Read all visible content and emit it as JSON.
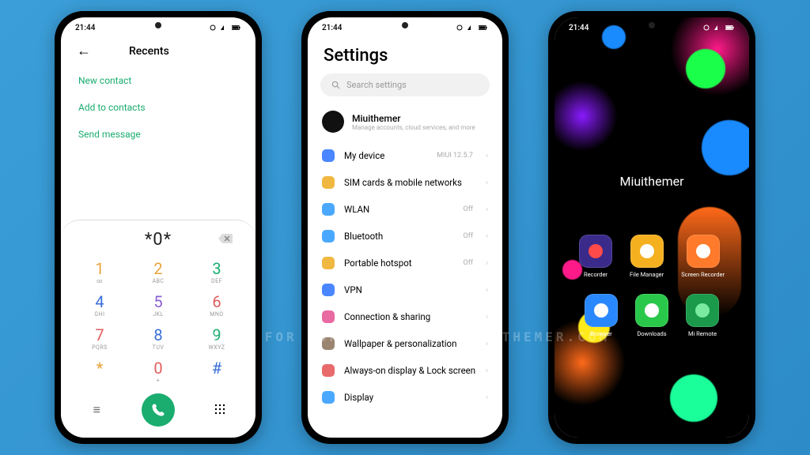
{
  "status": {
    "time": "21:44"
  },
  "watermark": "VISIT FOR MORE THEMES - MIUITHEMER.COM",
  "phone1": {
    "title": "Recents",
    "actions": [
      "New contact",
      "Add to contacts",
      "Send message"
    ],
    "dialed": "*0*",
    "keys": [
      {
        "d": "1",
        "l": "∞",
        "c": "#e8a33c"
      },
      {
        "d": "2",
        "l": "ABC",
        "c": "#e8a33c"
      },
      {
        "d": "3",
        "l": "DEF",
        "c": "#1aad6f"
      },
      {
        "d": "4",
        "l": "GHI",
        "c": "#3a6fd8"
      },
      {
        "d": "5",
        "l": "JKL",
        "c": "#8a5fd1"
      },
      {
        "d": "6",
        "l": "MNO",
        "c": "#e25b5b"
      },
      {
        "d": "7",
        "l": "PQRS",
        "c": "#e25b5b"
      },
      {
        "d": "8",
        "l": "TUV",
        "c": "#3a6fd8"
      },
      {
        "d": "9",
        "l": "WXYZ",
        "c": "#1aad6f"
      },
      {
        "d": "*",
        "l": "",
        "c": "#e8a33c"
      },
      {
        "d": "0",
        "l": "+",
        "c": "#e25b5b"
      },
      {
        "d": "#",
        "l": "",
        "c": "#3a6fd8"
      }
    ]
  },
  "phone2": {
    "title": "Settings",
    "search_placeholder": "Search settings",
    "account": {
      "name": "Miuithemer",
      "sub": "Manage accounts, cloud services, and more"
    },
    "items": [
      {
        "icon": "#4a86ff",
        "label": "My device",
        "value": "MIUI 12.5.7"
      },
      {
        "icon": "#f0b840",
        "label": "SIM cards & mobile networks",
        "value": ""
      },
      {
        "icon": "#4aa8ff",
        "label": "WLAN",
        "value": "Off"
      },
      {
        "icon": "#4aa8ff",
        "label": "Bluetooth",
        "value": "Off"
      },
      {
        "icon": "#f0b840",
        "label": "Portable hotspot",
        "value": "Off"
      },
      {
        "icon": "#4a86ff",
        "label": "VPN",
        "value": ""
      },
      {
        "icon": "#e86aa0",
        "label": "Connection & sharing",
        "value": ""
      },
      {
        "icon": "#9a8570",
        "label": "Wallpaper & personalization",
        "value": ""
      },
      {
        "icon": "#e86a6a",
        "label": "Always-on display & Lock screen",
        "value": ""
      },
      {
        "icon": "#4aa8ff",
        "label": "Display",
        "value": ""
      }
    ]
  },
  "phone3": {
    "label": "Miuithemer",
    "apps": [
      {
        "name": "Recorder",
        "bg": "#3a2a8a",
        "inner": "#ff4a4a"
      },
      {
        "name": "File Manager",
        "bg": "#f5b020",
        "inner": "#fff"
      },
      {
        "name": "Screen Recorder",
        "bg": "#ff7a2a",
        "inner": "#fff"
      },
      {
        "name": "Browser",
        "bg": "#2a88ff",
        "inner": "#fff"
      },
      {
        "name": "Downloads",
        "bg": "#2ac84a",
        "inner": "#fff"
      },
      {
        "name": "Mi Remote",
        "bg": "#1a9a4a",
        "inner": "#7aeaa0"
      }
    ]
  }
}
